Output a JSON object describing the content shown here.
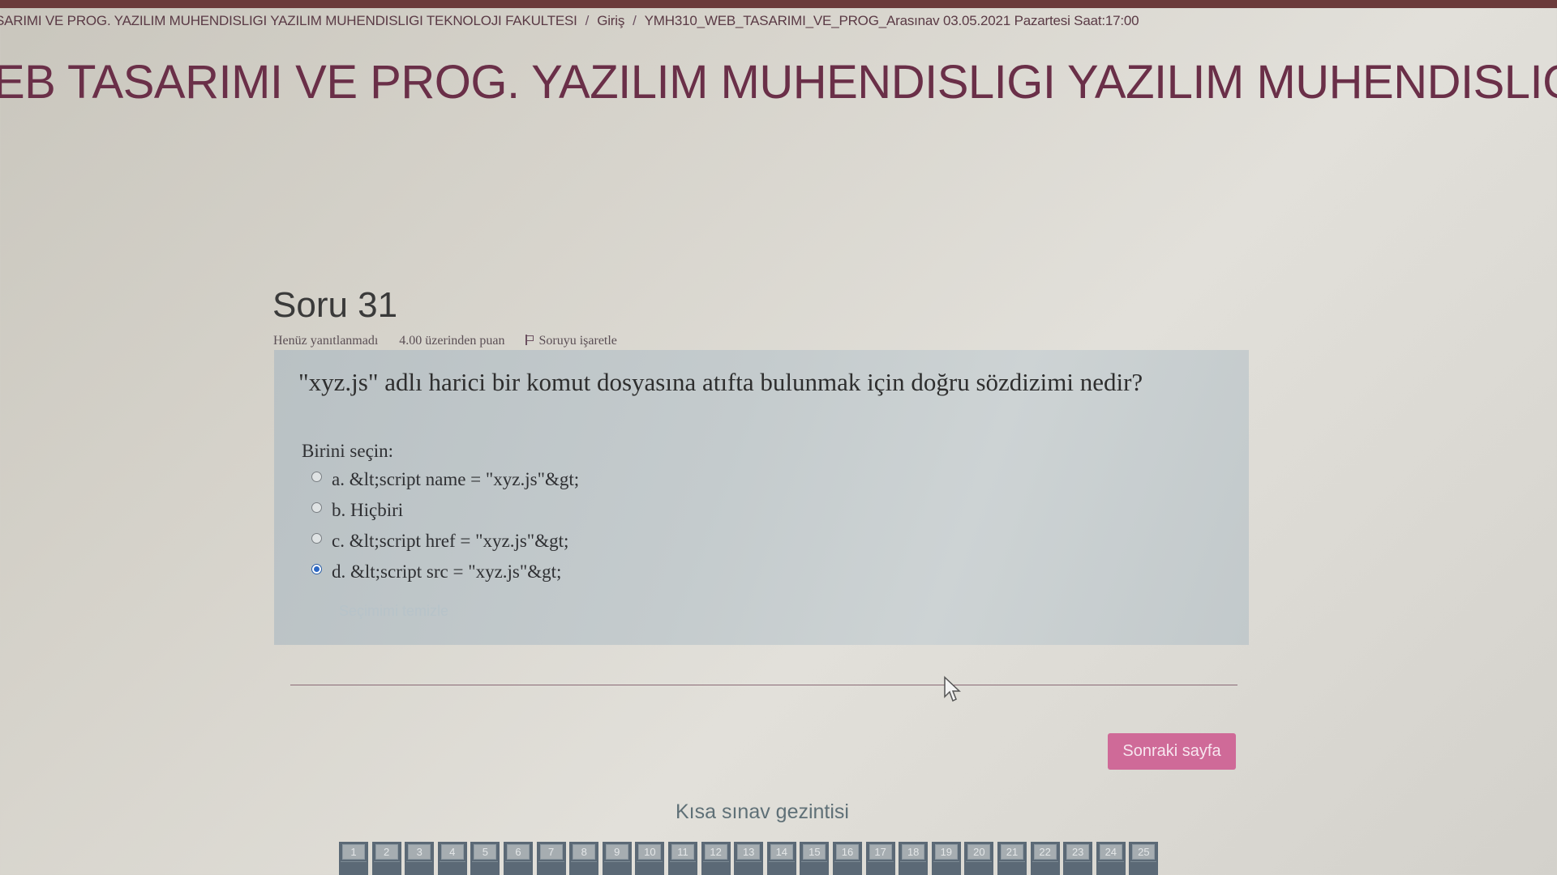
{
  "breadcrumb": {
    "items": [
      "SARIMI VE PROG. YAZILIM MUHENDISLIGI YAZILIM MUHENDISLIGI TEKNOLOJI FAKULTESI",
      "Giriş",
      "YMH310_WEB_TASARIMI_VE_PROG_Arasınav 03.05.2021 Pazartesi Saat:17:00"
    ],
    "separator": "/"
  },
  "course_title": "EB TASARIMI VE PROG. YAZILIM MUHENDISLIGI YAZILIM MUHENDISLIGI TEKN",
  "question": {
    "heading": "Soru 31",
    "status": "Henüz yanıtlanmadı",
    "points": "4.00 üzerinden puan",
    "flag_label": "Soruyu işaretle",
    "text": "\"xyz.js\" adlı harici bir komut dosyasına atıfta bulunmak için doğru sözdizimi nedir?",
    "choose_label": "Birini seçin:",
    "options": [
      {
        "label": "a. &lt;script name = \"xyz.js\"&gt;",
        "checked": false
      },
      {
        "label": "b. Hiçbiri",
        "checked": false
      },
      {
        "label": "c. &lt;script href = \"xyz.js\"&gt;",
        "checked": false
      },
      {
        "label": "d. &lt;script src = \"xyz.js\"&gt;",
        "checked": true
      }
    ],
    "clear_label": "Seçimimi temizle"
  },
  "next_button": "Sonraki sayfa",
  "quiz_nav": {
    "title": "Kısa sınav gezintisi",
    "pages": [
      "1",
      "2",
      "3",
      "4",
      "5",
      "6",
      "7",
      "8",
      "9",
      "10",
      "11",
      "12",
      "13",
      "14",
      "15",
      "16",
      "17",
      "18",
      "19",
      "20",
      "21",
      "22",
      "23",
      "24",
      "25"
    ]
  },
  "colors": {
    "accent": "#cf6a98",
    "title": "#6a2f48",
    "radio_selected": "#2b67c4"
  }
}
